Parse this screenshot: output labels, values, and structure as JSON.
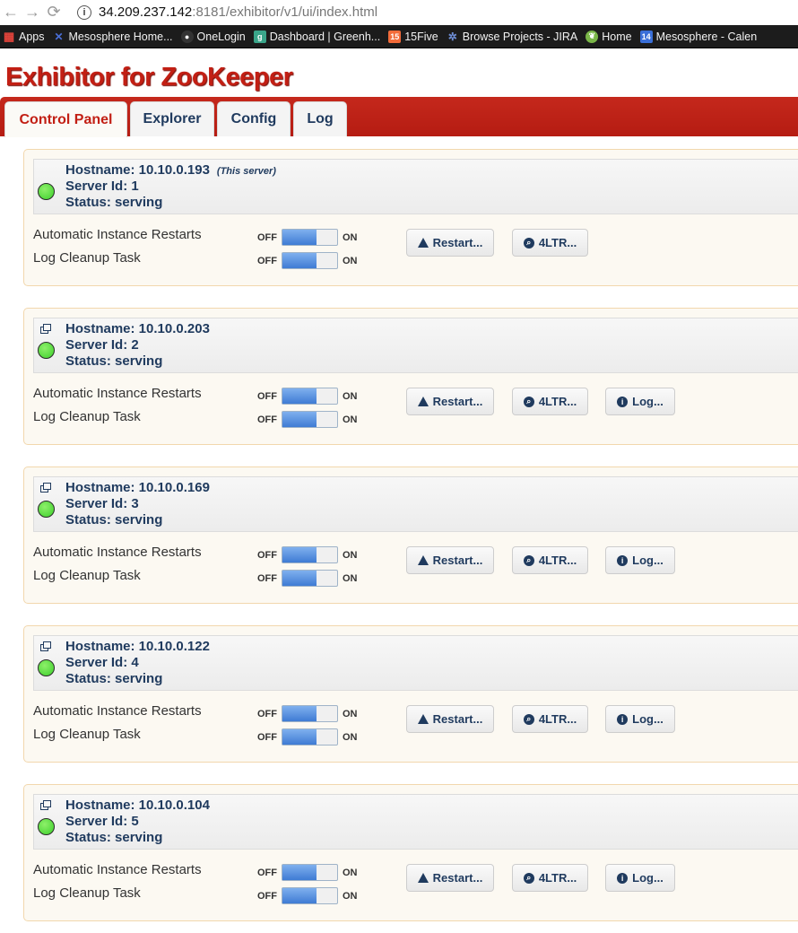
{
  "browser": {
    "url_host": "34.209.237.142",
    "url_rest": ":8181/exhibitor/v1/ui/index.html",
    "bookmarks": [
      {
        "label": "Apps",
        "icon": "apps-grid-icon",
        "color": "#e8453c"
      },
      {
        "label": "Mesosphere Home...",
        "icon": "mesosphere-icon",
        "color": "#4a6fd8"
      },
      {
        "label": "OneLogin",
        "icon": "onelogin-icon",
        "color": "#333333"
      },
      {
        "label": "Dashboard | Greenh...",
        "icon": "greenhouse-icon",
        "color": "#3aa58a"
      },
      {
        "label": "15Five",
        "icon": "fifteen-five-icon",
        "color": "#f26b3a",
        "glyph": "15"
      },
      {
        "label": "Browse Projects - JIRA",
        "icon": "jira-icon",
        "color": "#2a4f9a"
      },
      {
        "label": "Home",
        "icon": "home-leaf-icon",
        "color": "#7ab648"
      },
      {
        "label": "Mesosphere - Calen",
        "icon": "calendar-icon",
        "color": "#3a6fd8",
        "glyph": "14"
      }
    ]
  },
  "app": {
    "title": "Exhibitor for ZooKeeper",
    "tabs": [
      "Control Panel",
      "Explorer",
      "Config",
      "Log"
    ],
    "active_tab": "Control Panel"
  },
  "labels": {
    "automatic_restarts": "Automatic Instance Restarts",
    "log_cleanup": "Log Cleanup Task",
    "off": "OFF",
    "on": "ON",
    "restart": "Restart...",
    "fourltr": "4LTR...",
    "log": "Log...",
    "this_server": "(This server)"
  },
  "servers": [
    {
      "hostname": "Hostname: 10.10.0.193",
      "server_id": "Server Id: 1",
      "status": "Status: serving",
      "is_this_server": true
    },
    {
      "hostname": "Hostname: 10.10.0.203",
      "server_id": "Server Id: 2",
      "status": "Status: serving",
      "is_this_server": false
    },
    {
      "hostname": "Hostname: 10.10.0.169",
      "server_id": "Server Id: 3",
      "status": "Status: serving",
      "is_this_server": false
    },
    {
      "hostname": "Hostname: 10.10.0.122",
      "server_id": "Server Id: 4",
      "status": "Status: serving",
      "is_this_server": false
    },
    {
      "hostname": "Hostname: 10.10.0.104",
      "server_id": "Server Id: 5",
      "status": "Status: serving",
      "is_this_server": false
    }
  ]
}
